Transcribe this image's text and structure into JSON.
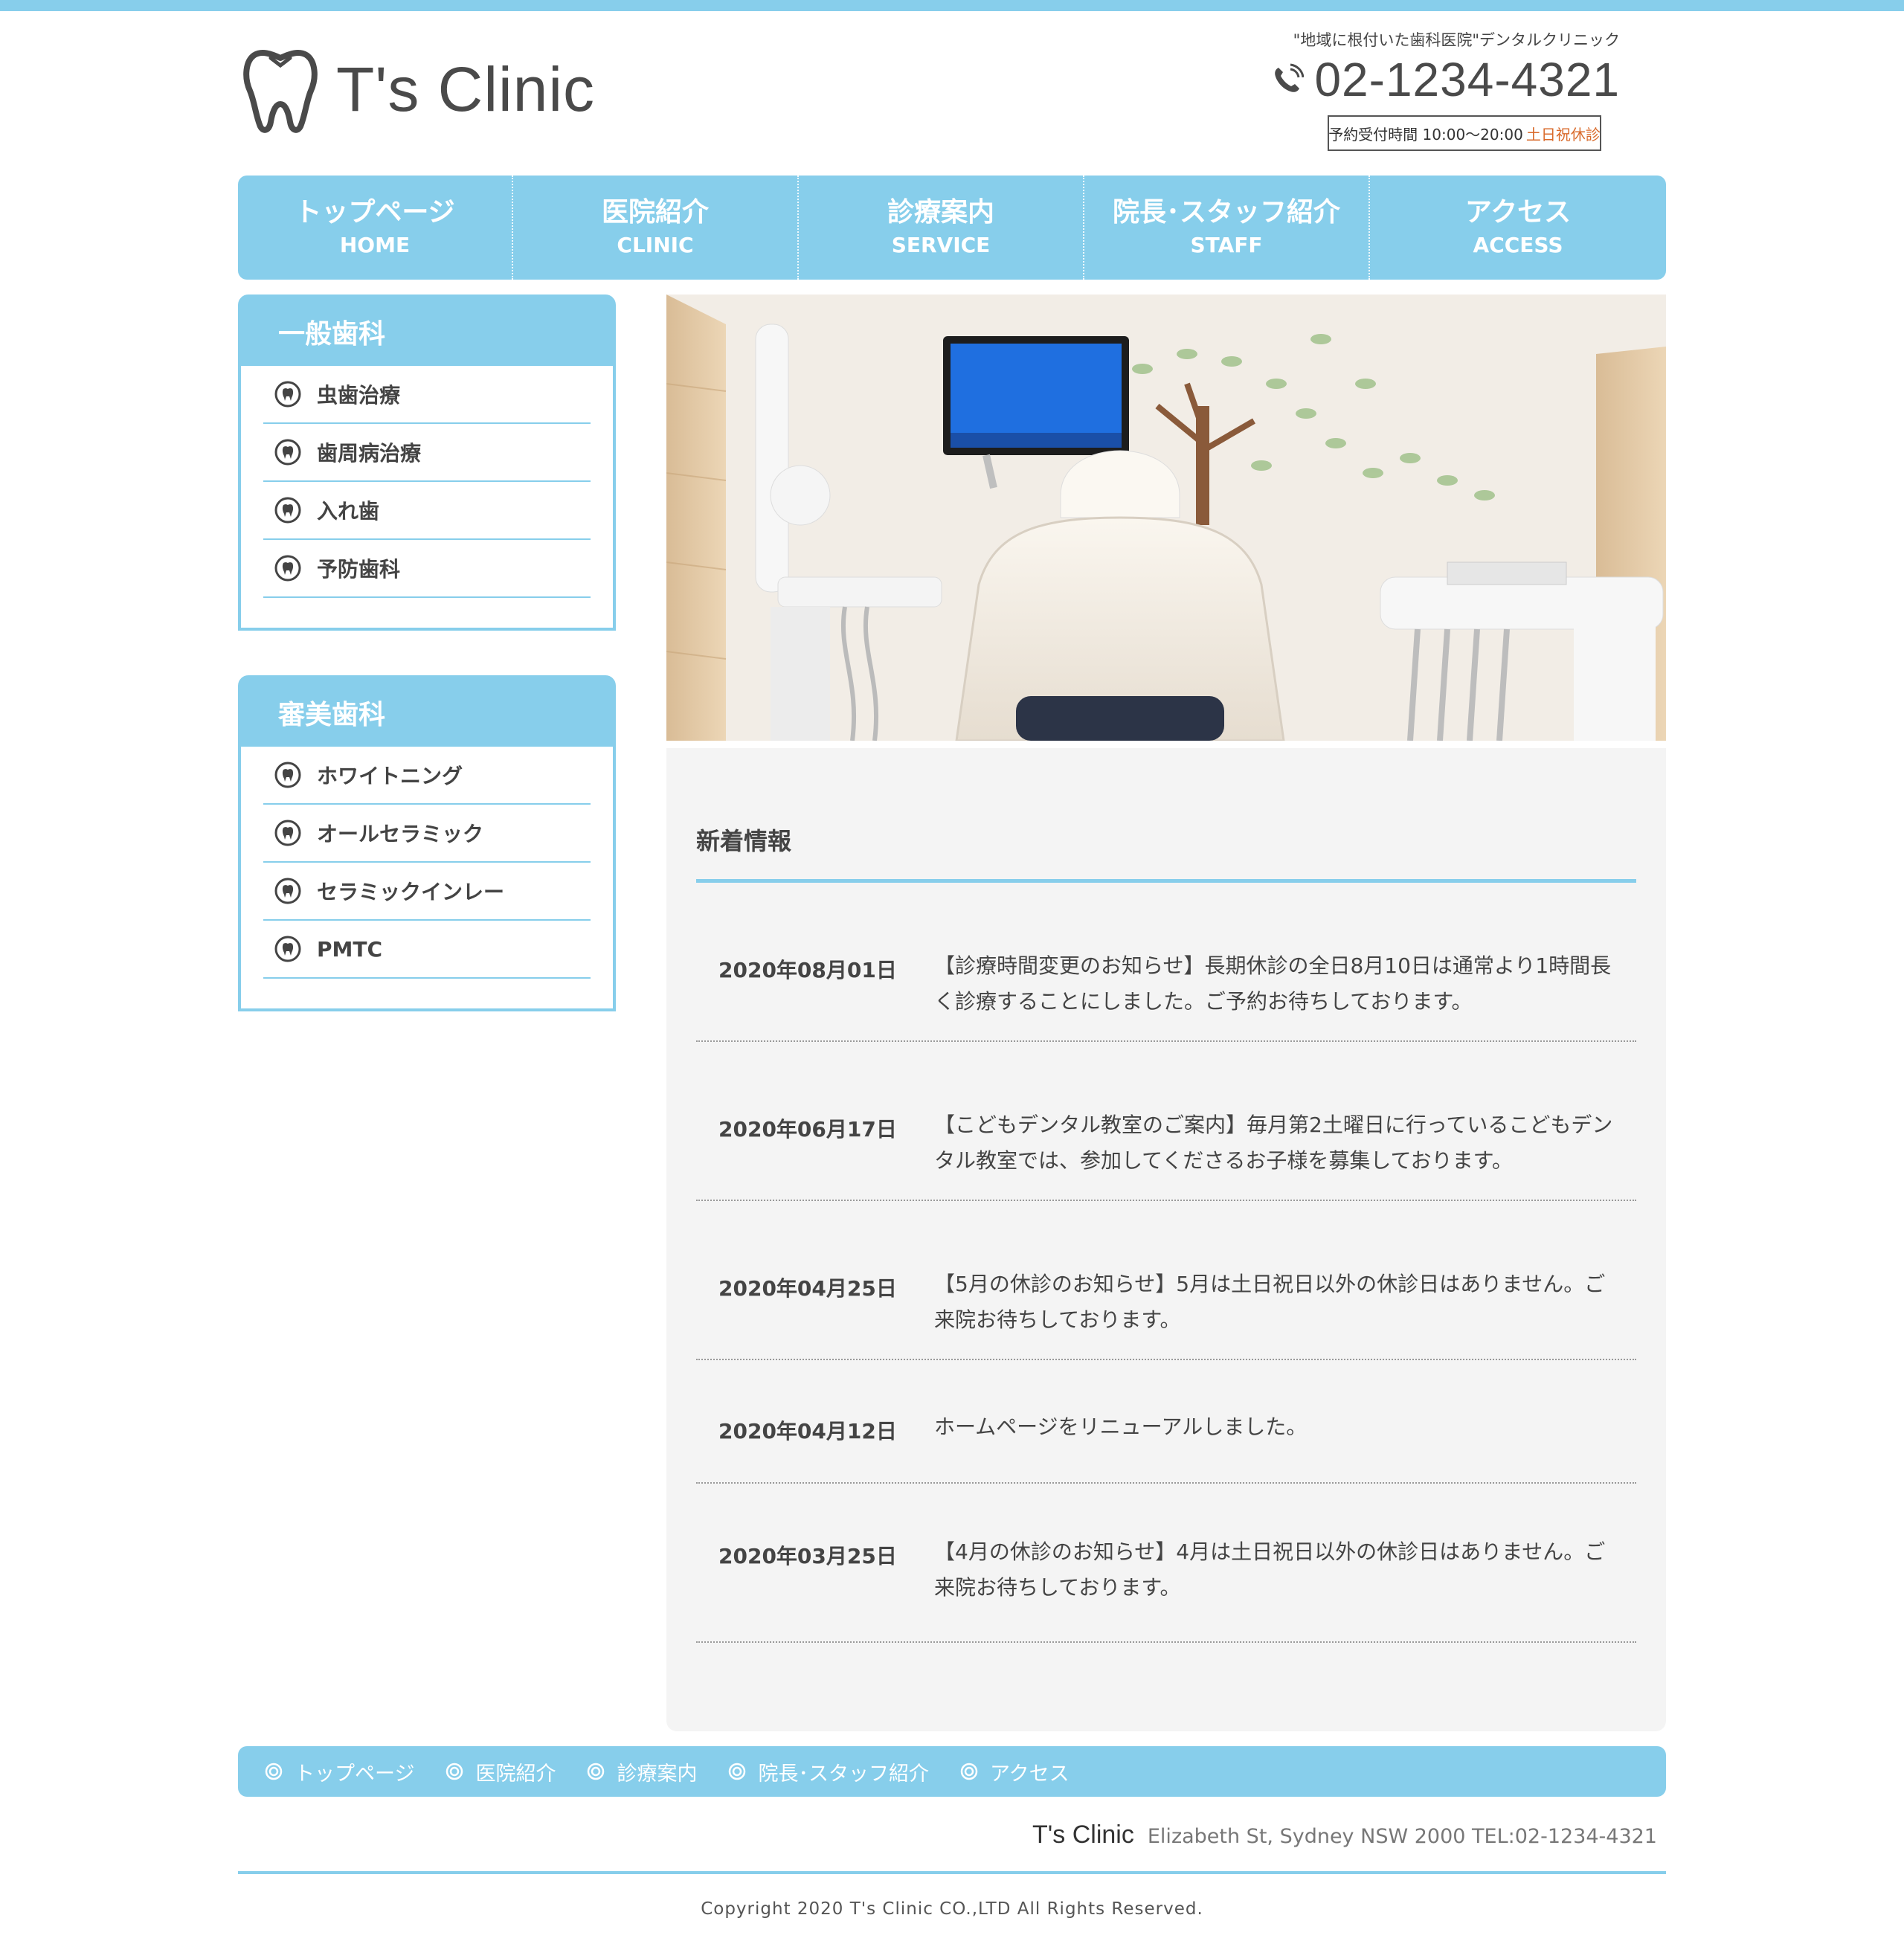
{
  "header": {
    "logo_text": "T's Clinic",
    "tagline": "\"地域に根付いた歯科医院\"デンタルクリニック",
    "phone": "02-1234-4321",
    "hours_label": "予約受付時間 10:00〜20:00",
    "hours_closed": "土日祝休診"
  },
  "gnav": [
    {
      "jp": "トップページ",
      "en": "HOME"
    },
    {
      "jp": "医院紹介",
      "en": "CLINIC"
    },
    {
      "jp": "診療案内",
      "en": "SERVICE"
    },
    {
      "jp": "院長･スタッフ紹介",
      "en": "STAFF"
    },
    {
      "jp": "アクセス",
      "en": "ACCESS"
    }
  ],
  "sidebar": {
    "general": {
      "title": "一般歯科",
      "items": [
        "虫歯治療",
        "歯周病治療",
        "入れ歯",
        "予防歯科"
      ]
    },
    "cosmetic": {
      "title": "審美歯科",
      "items": [
        "ホワイトニング",
        "オールセラミック",
        "セラミックインレー",
        "PMTC"
      ]
    }
  },
  "news": {
    "title": "新着情報",
    "items": [
      {
        "date": "2020年08月01日",
        "text": "【診療時間変更のお知らせ】長期休診の全日8月10日は通常より1時間長く診療することにしました。ご予約お待ちしております。"
      },
      {
        "date": "2020年06月17日",
        "text": "【こどもデンタル教室のご案内】毎月第2土曜日に行っているこどもデンタル教室では、参加してくださるお子様を募集しております。"
      },
      {
        "date": "2020年04月25日",
        "text": "【5月の休診のお知らせ】5月は土日祝日以外の休診日はありません。ご来院お待ちしております。"
      },
      {
        "date": "2020年04月12日",
        "text": "ホームページをリニューアルしました。"
      },
      {
        "date": "2020年03月25日",
        "text": "【4月の休診のお知らせ】4月は土日祝日以外の休診日はありません。ご来院お待ちしております。"
      }
    ]
  },
  "footer": {
    "nav": [
      "トップページ",
      "医院紹介",
      "診療案内",
      "院長･スタッフ紹介",
      "アクセス"
    ],
    "name": "T's Clinic",
    "address": "Elizabeth St, Sydney NSW 2000  TEL:02-1234-4321",
    "copyright": "Copyright 2020 T's Clinic CO.,LTD All Rights Reserved."
  },
  "colors": {
    "accent": "#87ceeb",
    "closed_text": "#d96a2b",
    "news_bg": "#f4f4f4"
  },
  "icons": [
    "tooth-logo-icon",
    "phone-icon",
    "tooth-bullet-icon",
    "ring-bullet-icon"
  ]
}
